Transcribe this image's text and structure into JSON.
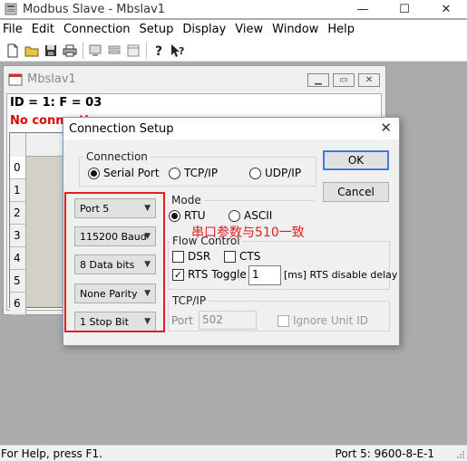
{
  "app": {
    "title": "Modbus Slave - Mbslav1"
  },
  "window_controls": {
    "minimize": "—",
    "maximize": "☐",
    "close": "✕"
  },
  "menu": [
    "File",
    "Edit",
    "Connection",
    "Setup",
    "Display",
    "View",
    "Window",
    "Help"
  ],
  "child": {
    "title": "Mbslav1",
    "id_line": "ID = 1: F = 03",
    "status": "No connection",
    "rows": [
      "0",
      "1",
      "2",
      "3",
      "4",
      "5",
      "6"
    ]
  },
  "dialog": {
    "title": "Connection Setup",
    "connection_label": "Connection",
    "conn_serial": "Serial Port",
    "conn_tcp": "TCP/IP",
    "conn_udp": "UDP/IP",
    "ok": "OK",
    "cancel": "Cancel",
    "port": "Port 5",
    "baud": "115200 Baud",
    "databits": "8 Data bits",
    "parity": "None Parity",
    "stopbit": "1 Stop Bit",
    "mode_label": "Mode",
    "mode_rtu": "RTU",
    "mode_ascii": "ASCII",
    "flow_label": "Flow Control",
    "dsr": "DSR",
    "cts": "CTS",
    "rts_toggle": "RTS Toggle",
    "rts_delay_value": "1",
    "rts_delay_label": "[ms] RTS disable delay",
    "tcpip_label": "TCP/IP",
    "tcp_port_label": "Port",
    "tcp_port_value": "502",
    "ignore_unit_id": "Ignore Unit ID"
  },
  "annotation": "串口参数与510一致",
  "statusbar": {
    "left": "For Help, press F1.",
    "right": "Port 5: 9600-8-E-1"
  },
  "colors": {
    "annotation_red": "#e02020",
    "error_red": "#e00000",
    "ok_border": "#3c7fd1"
  }
}
